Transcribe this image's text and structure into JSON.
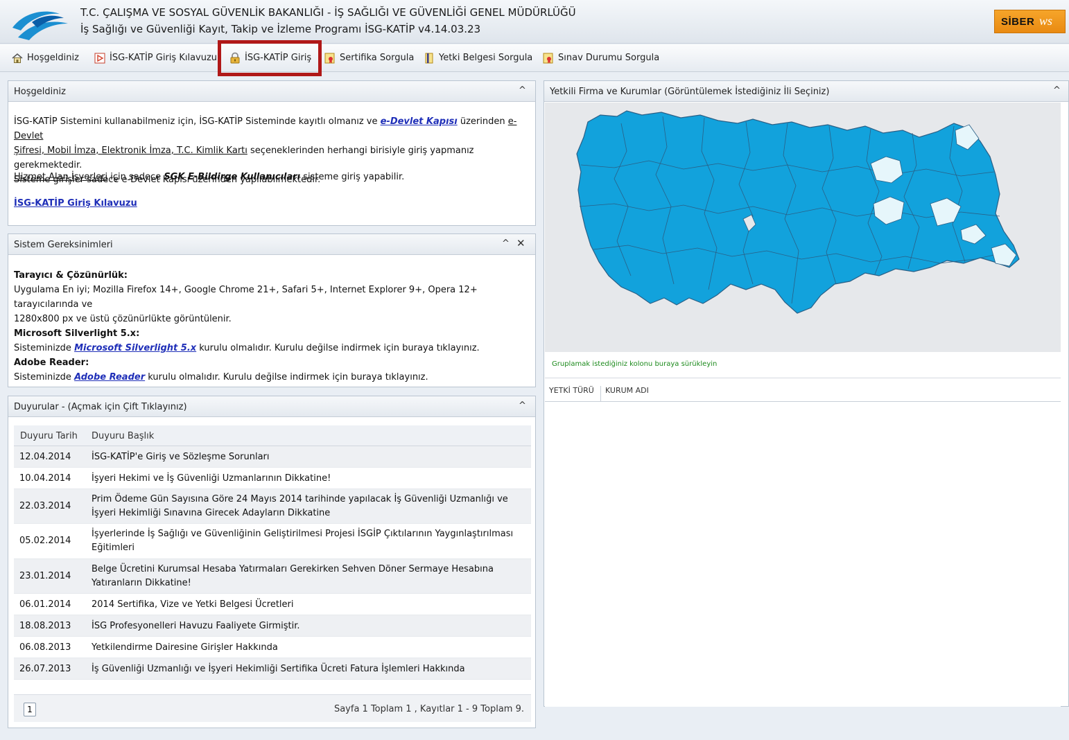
{
  "header": {
    "title": "T.C. ÇALIŞMA VE SOSYAL GÜVENLİK BAKANLIĞI - İŞ SAĞLIĞI VE GÜVENLİĞİ GENEL MÜDÜRLÜĞÜ",
    "subtitle": "İş Sağlığı ve Güvenliği Kayıt, Takip ve İzleme Programı İSG-KATİP v4.14.03.23",
    "brand_text": "SİBER",
    "brand_script": "ws",
    "brand_color": "#f0981e"
  },
  "toolbar": {
    "items": [
      {
        "label": "Hoşgeldiniz",
        "icon": "home-icon"
      },
      {
        "label": "İSG-KATİP Giriş Kılavuzu",
        "icon": "pdf-icon"
      },
      {
        "label": "İSG-KATİP Giriş",
        "icon": "lock-icon",
        "highlighted": true
      },
      {
        "label": "Sertifika Sorgula",
        "icon": "certificate-icon"
      },
      {
        "label": "Yetki Belgesi Sorgula",
        "icon": "document-icon"
      },
      {
        "label": "Sınav Durumu Sorgula",
        "icon": "certificate-icon"
      }
    ],
    "highlight_color": "#b01818"
  },
  "welcome": {
    "title": "Hoşgeldiniz",
    "p1_a": "İSG-KATİP Sistemini kullanabilmeniz için, İSG-KATİP Sisteminde kayıtlı olmanız ve ",
    "p1_link": "e-Devlet Kapısı",
    "p1_b": " üzerinden ",
    "p1_u1": "e-Devlet",
    "p1_u2": "Şifresi, Mobil İmza, Elektronik İmza, T.C. Kimlik Kartı",
    "p1_c": " seçeneklerinden herhangi birisiyle giriş yapmanız gerekmektedir.",
    "p1_d": "Sisteme girişler sadece e-Devlet Kapısı üzerinden yapılabilmektedir.",
    "p2_u": "Hizmet Alan İşyerleri",
    "p2_a": " için sadece ",
    "p2_bi": "SGK E-Bildirge Kullanıcıları",
    "p2_b": " sisteme giriş yapabilir.",
    "guide_link": "İSG-KATİP Giriş Kılavuzu"
  },
  "requirements": {
    "title": "Sistem Gereksinimleri",
    "h1": "Tarayıcı & Çözünürlük:",
    "t1": "Uygulama En iyi; Mozilla Firefox 14+, Google Chrome 21+, Safari 5+, Internet Explorer 9+, Opera 12+ tarayıcılarında ve",
    "t1b": "1280x800 px ve üstü çözünürlükte görüntülenir.",
    "h2": "Microsoft Silverlight 5.x:",
    "t2_a": "Sisteminizde ",
    "t2_link": "Microsoft Silverlight 5.x",
    "t2_b": " kurulu olmalıdır. Kurulu değilse indirmek için buraya tıklayınız.",
    "h3": "Adobe Reader:",
    "t3_a": "Sisteminizde ",
    "t3_link": "Adobe Reader",
    "t3_b": " kurulu olmalıdır. Kurulu değilse indirmek için buraya tıklayınız."
  },
  "announcements": {
    "title": "Duyurular - (Açmak için Çift Tıklayınız)",
    "col_date": "Duyuru Tarih",
    "col_title": "Duyuru Başlık",
    "rows": [
      {
        "date": "12.04.2014",
        "title": "İSG-KATİP'e Giriş ve Sözleşme Sorunları"
      },
      {
        "date": "10.04.2014",
        "title": "İşyeri Hekimi ve İş Güvenliği Uzmanlarının Dikkatine!"
      },
      {
        "date": "22.03.2014",
        "title": "Prim Ödeme Gün Sayısına Göre 24 Mayıs 2014 tarihinde yapılacak İş Güvenliği Uzmanlığı ve İşyeri Hekimliği Sınavına Girecek Adayların Dikkatine"
      },
      {
        "date": "05.02.2014",
        "title": "İşyerlerinde İş Sağlığı ve Güvenliğinin Geliştirilmesi Projesi İSGİP Çıktılarının Yaygınlaştırılması Eğitimleri"
      },
      {
        "date": "23.01.2014",
        "title": "Belge Ücretini Kurumsal Hesaba Yatırmaları Gerekirken Sehven Döner Sermaye Hesabına Yatıranların Dikkatine!"
      },
      {
        "date": "06.01.2014",
        "title": "2014 Sertifika, Vize ve Yetki Belgesi Ücretleri"
      },
      {
        "date": "18.08.2013",
        "title": "İSG Profesyonelleri Havuzu Faaliyete Girmiştir."
      },
      {
        "date": "06.08.2013",
        "title": "Yetkilendirme Dairesine Girişler Hakkında"
      },
      {
        "date": "26.07.2013",
        "title": "İş Güvenliği Uzmanlığı ve İşyeri Hekimliği Sertifika Ücreti Fatura İşlemleri Hakkında"
      }
    ],
    "page_button": "1",
    "page_info": "Sayfa 1 Toplam 1 , Kayıtlar 1 - 9 Toplam 9."
  },
  "firms": {
    "title": "Yetkili Firma ve Kurumlar (Görüntülemek İstediğiniz İli Seçiniz)",
    "map_color": "#12a2dc",
    "group_hint": "Gruplamak istediğiniz kolonu buraya sürükleyin",
    "col_type": "YETKİ TÜRÜ",
    "col_name": "KURUM ADI"
  }
}
